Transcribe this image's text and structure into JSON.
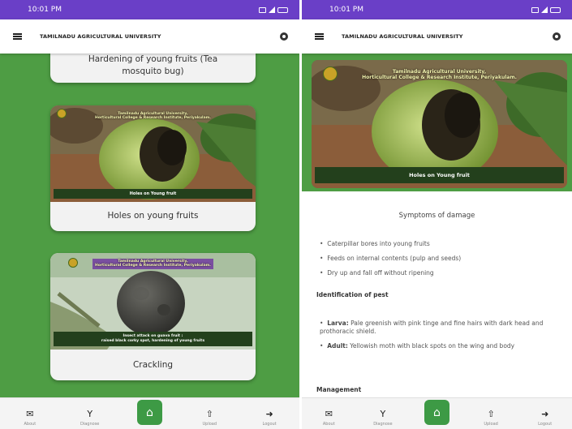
{
  "colors": {
    "status_bar": "#6a3fc7",
    "content_green": "#4e9d44",
    "home_button": "#3d9a45",
    "label_banner": "#23401c"
  },
  "left": {
    "status": {
      "time": "10:01 PM"
    },
    "appbar": {
      "title": "TAMILNADU AGRICULTURAL UNIVERSITY",
      "menu_icon": "hamburger-menu-icon",
      "settings_icon": "gear-icon"
    },
    "cards": [
      {
        "caption": "Hardening of young fruits (Tea mosquito bug)"
      },
      {
        "banner_line1": "Tamilnadu Agricultural University,",
        "banner_line2": "Horticultural College & Research Institute, Periyakulam.",
        "image_label": "Holes on Young fruit",
        "caption": "Holes on young fruits"
      },
      {
        "banner_line1": "Tamilnadu Agricultural University,",
        "banner_line2": "Horticultural College & Research Institute, Periyakulam.",
        "image_label_line1": "Insect attack on guava fruit :",
        "image_label_line2": "raised black corky spot, hardening of young fruits",
        "caption": "Crackling"
      }
    ],
    "nav": [
      {
        "label": "About",
        "icon": "envelope-icon"
      },
      {
        "label": "Diagnose",
        "icon": "sprout-icon"
      },
      {
        "label": "",
        "icon": "home-icon"
      },
      {
        "label": "Upload",
        "icon": "upload-icon"
      },
      {
        "label": "Logout",
        "icon": "logout-icon"
      }
    ]
  },
  "right": {
    "status": {
      "time": "10:01 PM"
    },
    "appbar": {
      "title": "TAMILNADU AGRICULTURAL UNIVERSITY",
      "menu_icon": "hamburger-menu-icon",
      "settings_icon": "gear-icon"
    },
    "hero": {
      "banner_line1": "Tamilnadu Agricultural University,",
      "banner_line2": "Horticultural College & Research Institute, Periyakulam.",
      "image_label": "Holes on Young fruit"
    },
    "symptoms": {
      "title": "Symptoms of damage",
      "items": [
        "Caterpillar bores into young fruits",
        "Feeds on internal contents (pulp and seeds)",
        "Dry up and fall off without ripening"
      ]
    },
    "identification": {
      "title": "Identification of pest",
      "larva_label": "Larva:",
      "larva_text": "Pale greenish with pink tinge and fine hairs with dark head and prothoracic shield.",
      "adult_label": "Adult:",
      "adult_text": "Yellowish moth with black spots on the wing and body"
    },
    "management_title": "Management",
    "nav": [
      {
        "label": "About",
        "icon": "envelope-icon"
      },
      {
        "label": "Diagnose",
        "icon": "sprout-icon"
      },
      {
        "label": "",
        "icon": "home-icon"
      },
      {
        "label": "Upload",
        "icon": "upload-icon"
      },
      {
        "label": "Logout",
        "icon": "logout-icon"
      }
    ]
  }
}
